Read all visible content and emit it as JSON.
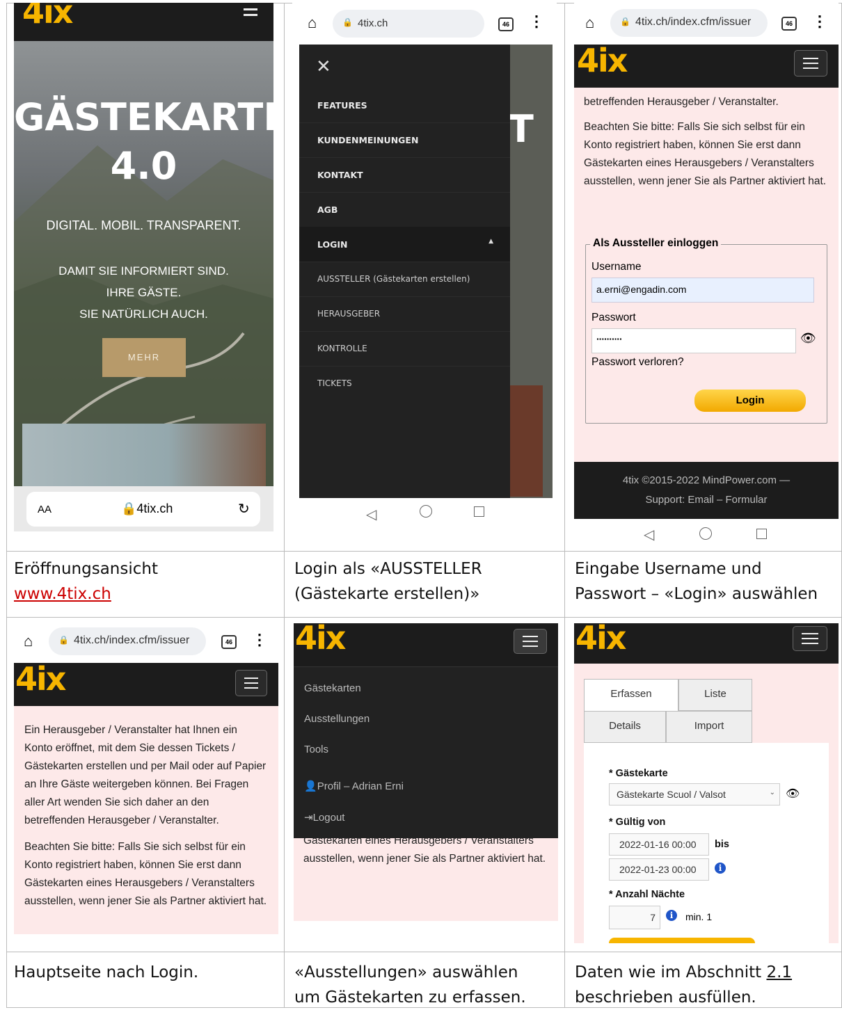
{
  "cells": [
    {
      "caption_lines": [
        "Eröffnungsansicht"
      ],
      "caption_link": "www.4tix.ch",
      "hero": {
        "title_line1": "GÄSTEKARTE",
        "title_line2": "4.0",
        "tagline": "DIGITAL. MOBIL. TRANSPARENT.",
        "lines": [
          "DAMIT SIE  INFORMIERT SIND.",
          "IHRE GÄSTE.",
          "SIE NATÜRLICH AUCH."
        ],
        "button": "MEHR"
      },
      "safari_bar": {
        "aa": "AA",
        "url": "4tix.ch"
      }
    },
    {
      "caption_lines": [
        "Login als  «AUSSTELLER",
        "(Gästekarte erstellen)»"
      ],
      "url": "4tix.ch",
      "tab_count": "46",
      "menu": [
        "FEATURES",
        "KUNDENMEINUNGEN",
        "KONTAKT",
        "AGB",
        "LOGIN",
        "AUSSTELLER (Gästekarten erstellen)",
        "HERAUSGEBER",
        "KONTROLLE",
        "TICKETS"
      ]
    },
    {
      "caption_lines": [
        "Eingabe Username und",
        "Passwort – «Login» auswählen"
      ],
      "url": "4tix.ch/index.cfm/issuer",
      "tab_count": "46",
      "text_top": "betreffenden Herausgeber / Veranstalter.",
      "text_note": "Beachten Sie bitte: Falls Sie sich selbst für ein Konto registriert haben, können Sie erst dann Gästekarten eines Herausgebers / Veranstalters ausstellen, wenn jener Sie als Partner aktiviert hat.",
      "legend": "Als Aussteller einloggen",
      "username_label": "Username",
      "username_value": "a.erni@engadin.com",
      "password_label": "Passwort",
      "password_value": "··········",
      "forgot": "Passwort verloren?",
      "login_button": "Login",
      "footer_line1": "4tix ©2015-2022 MindPower.com  —",
      "footer_line2": "Support:  Email  – Formular"
    },
    {
      "caption_lines": [
        "Hauptseite nach Login."
      ],
      "url": "4tix.ch/index.cfm/issuer",
      "tab_count": "46",
      "text_intro": "Ein Herausgeber / Veranstalter hat Ihnen ein Konto eröffnet, mit dem Sie dessen Tickets / Gästekarten erstellen und per Mail oder auf Papier an Ihre Gäste weitergeben können. Bei Fragen aller Art wenden Sie sich daher an den betreffenden Herausgeber / Veranstalter.",
      "text_note": "Beachten Sie bitte: Falls Sie sich selbst für ein Konto registriert haben, können Sie erst dann Gästekarten eines Herausgebers / Veranstalters ausstellen, wenn jener Sie als Partner aktiviert hat."
    },
    {
      "caption_lines": [
        " «Ausstellungen» auswählen",
        "um Gästekarten zu erfassen."
      ],
      "menu": [
        "Gästekarten",
        "Ausstellungen",
        "Tools",
        "Profil – Adrian Erni",
        "Logout"
      ],
      "text_behind": "Gästekarten eines Herausgebers / Veranstalters ausstellen, wenn jener Sie als Partner aktiviert hat."
    },
    {
      "caption_pre": "Daten wie im Abschnitt ",
      "caption_ref": "2.1",
      "caption_line2": "beschrieben ausfüllen.",
      "tabs": [
        "Erfassen",
        "Liste",
        "Details",
        "Import"
      ],
      "card_label": "Gästekarte",
      "card_value": "Gästekarte Scuol / Valsot",
      "valid_label": "Gültig von",
      "valid_from": "2022-01-16 00:00",
      "bis": "bis",
      "valid_to": "2022-01-23 00:00",
      "nights_label": "Anzahl Nächte",
      "nights_value": "7",
      "nights_min": "min. 1"
    }
  ],
  "brand": {
    "four": "4",
    "ix": "ix"
  },
  "colors": {
    "accent": "#f7b500",
    "dark": "#1c1c1c",
    "pink": "#fde9e9",
    "link": "#cc0000"
  }
}
